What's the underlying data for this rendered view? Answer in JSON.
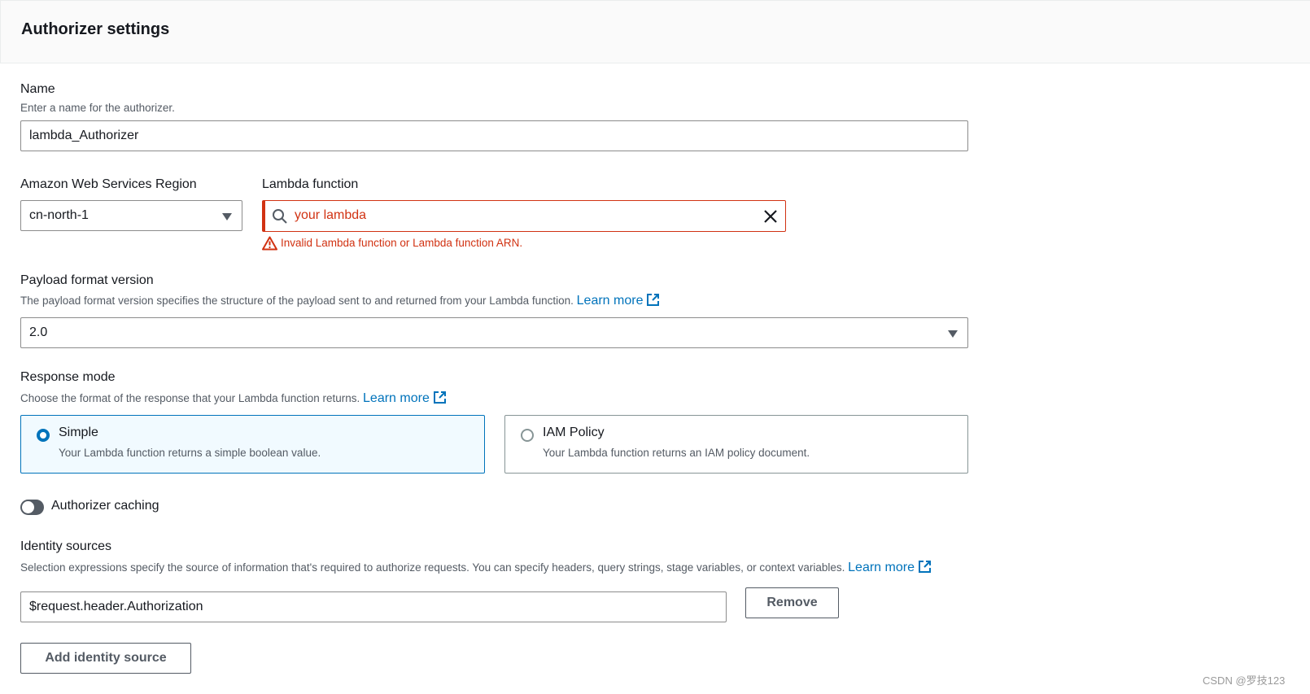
{
  "panel": {
    "title": "Authorizer settings"
  },
  "name_field": {
    "label": "Name",
    "description": "Enter a name for the authorizer.",
    "value": "lambda_Authorizer"
  },
  "region": {
    "label": "Amazon Web Services Region",
    "value": "cn-north-1"
  },
  "lambda": {
    "label": "Lambda function",
    "value": "your lambda",
    "error": "Invalid Lambda function or Lambda function ARN."
  },
  "payload": {
    "label": "Payload format version",
    "description": "The payload format version specifies the structure of the payload sent to and returned from your Lambda function.",
    "learn_more": "Learn more",
    "value": "2.0"
  },
  "response_mode": {
    "label": "Response mode",
    "description": "Choose the format of the response that your Lambda function returns.",
    "learn_more": "Learn more",
    "options": [
      {
        "title": "Simple",
        "desc": "Your Lambda function returns a simple boolean value.",
        "selected": true
      },
      {
        "title": "IAM Policy",
        "desc": "Your Lambda function returns an IAM policy document.",
        "selected": false
      }
    ]
  },
  "caching": {
    "label": "Authorizer caching",
    "enabled": false
  },
  "identity": {
    "label": "Identity sources",
    "description": "Selection expressions specify the source of information that's required to authorize requests. You can specify headers, query strings, stage variables, or context variables.",
    "learn_more": "Learn more",
    "value": "$request.header.Authorization",
    "remove_label": "Remove",
    "add_label": "Add identity source"
  },
  "watermark": "CSDN @罗技123",
  "colors": {
    "link": "#0073bb",
    "error": "#d13212",
    "selected_bg": "#f1faff"
  }
}
